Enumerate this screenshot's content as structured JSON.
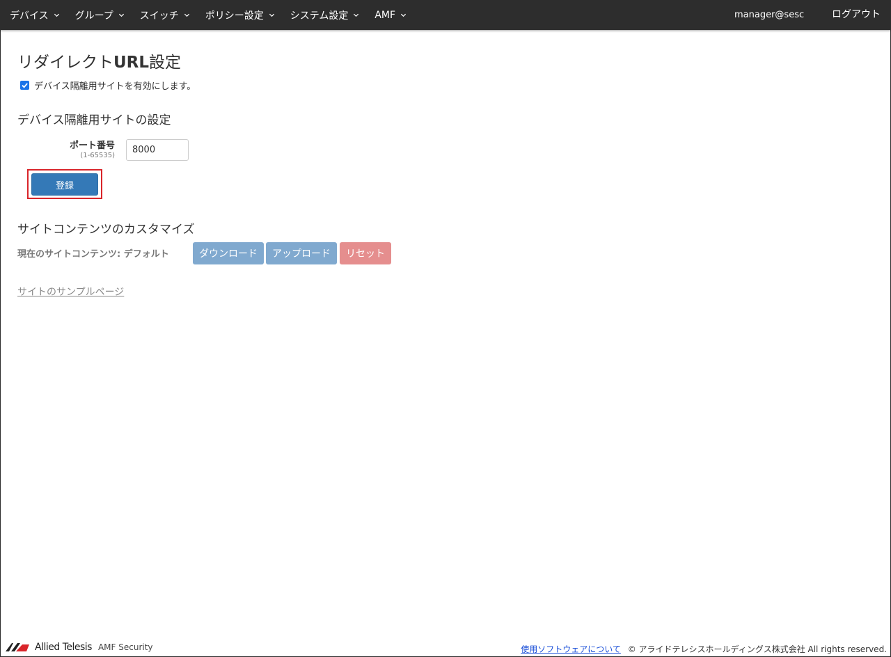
{
  "nav": {
    "items": [
      {
        "label": "デバイス"
      },
      {
        "label": "グループ"
      },
      {
        "label": "スイッチ"
      },
      {
        "label": "ポリシー設定"
      },
      {
        "label": "システム設定"
      },
      {
        "label": "AMF"
      }
    ],
    "user": "manager@sesc",
    "logout": "ログアウト"
  },
  "page": {
    "title_prefix": "リダイレクト",
    "title_bold": "URL",
    "title_suffix": "設定",
    "enable_checkbox": {
      "label": "デバイス隔離用サイトを有効にします。",
      "checked": true
    }
  },
  "site_settings": {
    "heading": "デバイス隔離用サイトの設定",
    "port_label": "ポート番号",
    "port_range": "(1-65535)",
    "port_value": "8000",
    "submit_label": "登録"
  },
  "customize": {
    "heading": "サイトコンテンツのカスタマイズ",
    "current_label": "現在のサイトコンテンツ: デフォルト",
    "download_label": "ダウンロード",
    "upload_label": "アップロード",
    "reset_label": "リセット",
    "sample_link": "サイトのサンプルページ"
  },
  "footer": {
    "logo_text": "Allied Telesis",
    "product": "AMF Security",
    "software_link": "使用ソフトウェアについて",
    "copyright": "© アライドテレシスホールディングス株式会社 All rights reserved."
  },
  "colors": {
    "navbar_bg": "#2d2d2d",
    "primary": "#3479b7",
    "disabled_primary": "#80a9cf",
    "disabled_danger": "#e58e8e",
    "highlight": "#d9252a"
  }
}
